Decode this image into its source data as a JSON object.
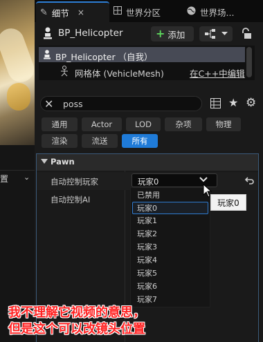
{
  "viewport": {
    "left_setting_label": "置",
    "left_setting_chevron": "⌄"
  },
  "tabs": [
    {
      "label": "细节",
      "icon": "pencil-icon",
      "close": "×",
      "active": true
    },
    {
      "label": "世界分区",
      "icon": "grid-map-icon"
    },
    {
      "label": "世界场...",
      "icon": "globe-icon"
    }
  ],
  "object": {
    "title": "BP_Helicopter",
    "add_label": "添加"
  },
  "tree": {
    "rows": [
      {
        "label": "BP_Helicopter （自我）"
      },
      {
        "label": "网格体 (VehicleMesh)",
        "action": "在C++中编辑"
      }
    ]
  },
  "search": {
    "value": "poss",
    "clear": "✕"
  },
  "filters": {
    "row1": [
      "通用",
      "Actor",
      "LOD",
      "杂项",
      "物理"
    ],
    "row2": [
      "渲染",
      "流送",
      "所有"
    ],
    "active": "所有"
  },
  "section": {
    "title": "Pawn",
    "properties": [
      {
        "label": "自动控制玩家",
        "value": "玩家0"
      },
      {
        "label": "自动控制AI"
      }
    ]
  },
  "dropdown": {
    "options": [
      "已禁用",
      "玩家0",
      "玩家1",
      "玩家2",
      "玩家3",
      "玩家4",
      "玩家5",
      "玩家6",
      "玩家7"
    ],
    "selected": "玩家0"
  },
  "tooltip": "玩家0",
  "subtitle": {
    "line1": "我不理解它视频的意思，",
    "line2": "但是这个可以改镜头位置"
  },
  "colors": {
    "accent": "#1f7bd8",
    "add_green": "#5cd35c",
    "subtitle_red": "#ff2222"
  }
}
